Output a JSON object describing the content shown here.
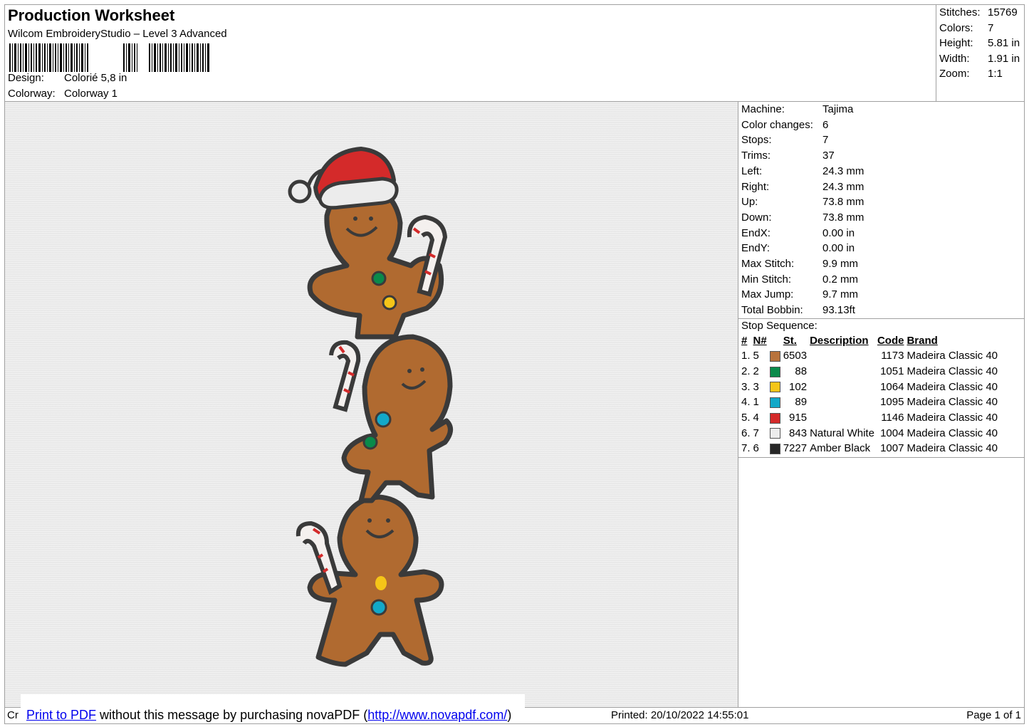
{
  "header": {
    "title": "Production Worksheet",
    "software": "Wilcom EmbroideryStudio – Level 3 Advanced",
    "barcode_text": "é ,",
    "design_label": "Design:",
    "design_value": "Colorié 5,8 in",
    "colorway_label": "Colorway:",
    "colorway_value": "Colorway 1"
  },
  "summary": {
    "rows": [
      {
        "label": "Stitches:",
        "value": "15769"
      },
      {
        "label": "Colors:",
        "value": "7"
      },
      {
        "label": "Height:",
        "value": "5.81 in"
      },
      {
        "label": "Width:",
        "value": "1.91 in"
      },
      {
        "label": "Zoom:",
        "value": "1:1"
      }
    ]
  },
  "details": {
    "rows": [
      {
        "label": "Machine:",
        "value": "Tajima"
      },
      {
        "label": "Color changes:",
        "value": "6"
      },
      {
        "label": "Stops:",
        "value": "7"
      },
      {
        "label": "Trims:",
        "value": "37"
      },
      {
        "label": "Left:",
        "value": "24.3 mm"
      },
      {
        "label": "Right:",
        "value": "24.3 mm"
      },
      {
        "label": "Up:",
        "value": "73.8 mm"
      },
      {
        "label": "Down:",
        "value": "73.8 mm"
      },
      {
        "label": "EndX:",
        "value": "0.00 in"
      },
      {
        "label": "EndY:",
        "value": "0.00 in"
      },
      {
        "label": "Max Stitch:",
        "value": "9.9 mm"
      },
      {
        "label": "Min Stitch:",
        "value": "0.2 mm"
      },
      {
        "label": "Max Jump:",
        "value": "9.7 mm"
      },
      {
        "label": "Total Bobbin:",
        "value": "93.13ft"
      }
    ],
    "stop_sequence_label": "Stop Sequence:",
    "columns": [
      "#",
      "N#",
      "St.",
      "Description",
      "Code",
      "Brand"
    ],
    "stops": [
      {
        "idx": "1.",
        "n": "5",
        "color": "#b8733c",
        "st": "6503",
        "desc": "",
        "code": "1173",
        "brand": "Madeira Classic 40"
      },
      {
        "idx": "2.",
        "n": "2",
        "color": "#0a8a4a",
        "st": "88",
        "desc": "",
        "code": "1051",
        "brand": "Madeira Classic 40"
      },
      {
        "idx": "3.",
        "n": "3",
        "color": "#f5c518",
        "st": "102",
        "desc": "",
        "code": "1064",
        "brand": "Madeira Classic 40"
      },
      {
        "idx": "4.",
        "n": "1",
        "color": "#12a8c8",
        "st": "89",
        "desc": "",
        "code": "1095",
        "brand": "Madeira Classic 40"
      },
      {
        "idx": "5.",
        "n": "4",
        "color": "#d42a2a",
        "st": "915",
        "desc": "",
        "code": "1146",
        "brand": "Madeira Classic 40"
      },
      {
        "idx": "6.",
        "n": "7",
        "color": "#ececec",
        "st": "843",
        "desc": "Natural White",
        "code": "1004",
        "brand": "Madeira Classic 40"
      },
      {
        "idx": "7.",
        "n": "6",
        "color": "#262626",
        "st": "7227",
        "desc": "Amber Black",
        "code": "1007",
        "brand": "Madeira Classic 40"
      }
    ]
  },
  "footer": {
    "left_stub": "Cr",
    "nova_link1": "Print to PDF",
    "nova_text": " without this message by purchasing novaPDF (",
    "nova_link2": "http://www.novapdf.com/",
    "nova_close": ")",
    "printed": "Printed: 20/10/2022 14:55:01",
    "page": "Page 1 of 1"
  },
  "colors": {
    "gingerbread": "#b06a30",
    "outline": "#3a3a3a",
    "hat_red": "#d42a2a",
    "hat_white": "#ececec",
    "green": "#0a8a4a",
    "yellow": "#f5c518",
    "teal": "#12a8c8"
  }
}
